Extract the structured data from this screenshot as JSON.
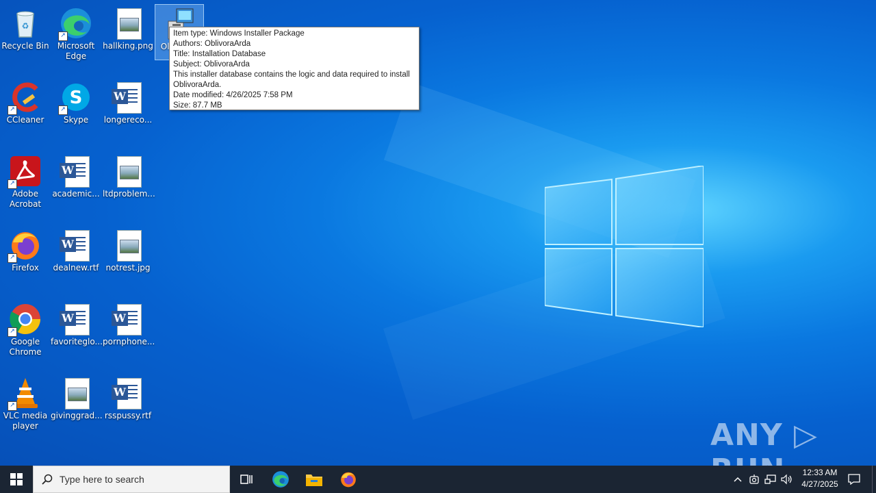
{
  "desktop": {
    "icons": [
      {
        "label": "Recycle Bin"
      },
      {
        "label": "Microsoft Edge"
      },
      {
        "label": "hallking.png"
      },
      {
        "label": "Ol... Se..."
      },
      {
        "label": "CCleaner"
      },
      {
        "label": "Skype"
      },
      {
        "label": "longereco..."
      },
      {
        "label": "Adobe Acrobat"
      },
      {
        "label": "academic..."
      },
      {
        "label": "ltdproblem..."
      },
      {
        "label": "Firefox"
      },
      {
        "label": "dealnew.rtf"
      },
      {
        "label": "notrest.jpg"
      },
      {
        "label": "Google Chrome"
      },
      {
        "label": "favoriteglo..."
      },
      {
        "label": "pornphone..."
      },
      {
        "label": "VLC media player"
      },
      {
        "label": "givinggrad..."
      },
      {
        "label": "rsspussy.rtf"
      }
    ]
  },
  "tooltip": {
    "lines": [
      "Item type: Windows Installer Package",
      "Authors: OblivoraArda",
      "Title: Installation Database",
      "Subject: OblivoraArda",
      "This installer database contains the logic and data required to install",
      "OblivoraArda.",
      "Date modified: 4/26/2025 7:58 PM",
      "Size: 87.7 MB"
    ]
  },
  "watermark": "ANY ▷ RUN",
  "taskbar": {
    "search_placeholder": "Type here to search",
    "time": "12:33 AM",
    "date": "4/27/2025",
    "pinned": [
      "task-view-icon",
      "edge-icon",
      "file-explorer-icon",
      "firefox-icon"
    ]
  },
  "colors": {
    "taskbar": "#1b2533",
    "desktop_accent": "#0a78e0"
  }
}
